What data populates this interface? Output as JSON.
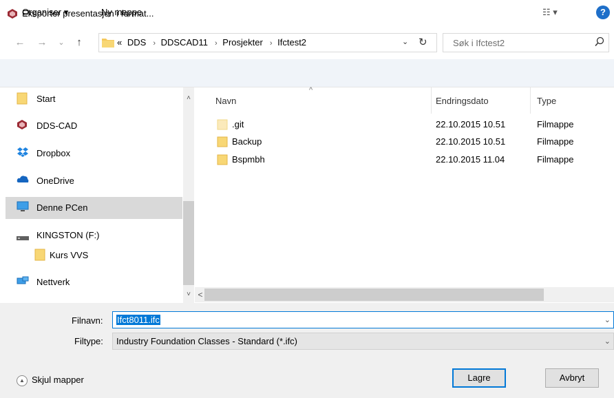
{
  "window": {
    "title": "Eksporter presentasjon i format...",
    "close_glyph": "×"
  },
  "nav": {
    "back_glyph": "←",
    "forward_glyph": "→",
    "recent_glyph": "⌄",
    "up_glyph": "↑"
  },
  "address": {
    "prefix": "«",
    "crumbs": [
      "DDS",
      "DDSCAD11",
      "Prosjekter",
      "Ifctest2"
    ],
    "sep": "›",
    "dropdown_glyph": "⌄",
    "refresh_glyph": "↻"
  },
  "search": {
    "placeholder": "Søk i Ifctest2"
  },
  "toolbar": {
    "organize": "Organiser ▾",
    "new_folder": "Ny mappe",
    "view": "☷ ▾",
    "help": "?"
  },
  "sidebar": {
    "items": [
      {
        "label": "Start",
        "icon": "folder-icon"
      },
      {
        "label": "DDS-CAD",
        "icon": "dds-cad-icon"
      },
      {
        "label": "Dropbox",
        "icon": "dropbox-icon"
      },
      {
        "label": "OneDrive",
        "icon": "onedrive-icon"
      },
      {
        "label": "Denne PCen",
        "icon": "computer-icon"
      },
      {
        "label": "KINGSTON (F:)",
        "icon": "drive-icon"
      },
      {
        "label": "Kurs VVS",
        "icon": "folder-icon"
      },
      {
        "label": "Nettverk",
        "icon": "network-icon"
      }
    ],
    "scroll_up": "˄",
    "scroll_down": "˅"
  },
  "filelist": {
    "columns": [
      "Navn",
      "Endringsdato",
      "Type"
    ],
    "rows": [
      {
        "name": ".git",
        "date": "22.10.2015 10.51",
        "type": "Filmappe",
        "hidden": true
      },
      {
        "name": "Backup",
        "date": "22.10.2015 10.51",
        "type": "Filmappe",
        "hidden": false
      },
      {
        "name": "Bspmbh",
        "date": "22.10.2015 11.04",
        "type": "Filmappe",
        "hidden": false
      }
    ],
    "scroll_left": "<"
  },
  "form": {
    "filename_label": "Filnavn:",
    "filename_value": "Ifct8011.ifc",
    "filetype_label": "Filtype:",
    "filetype_value": "Industry Foundation Classes - Standard (*.ifc)",
    "dropdown_glyph": "⌄"
  },
  "footer": {
    "hide_folders": "Skjul mapper",
    "save": "Lagre",
    "cancel": "Avbryt"
  },
  "colors": {
    "accent": "#0078d7",
    "folder": "#f5c85c",
    "selection": "#d9d9d9"
  }
}
